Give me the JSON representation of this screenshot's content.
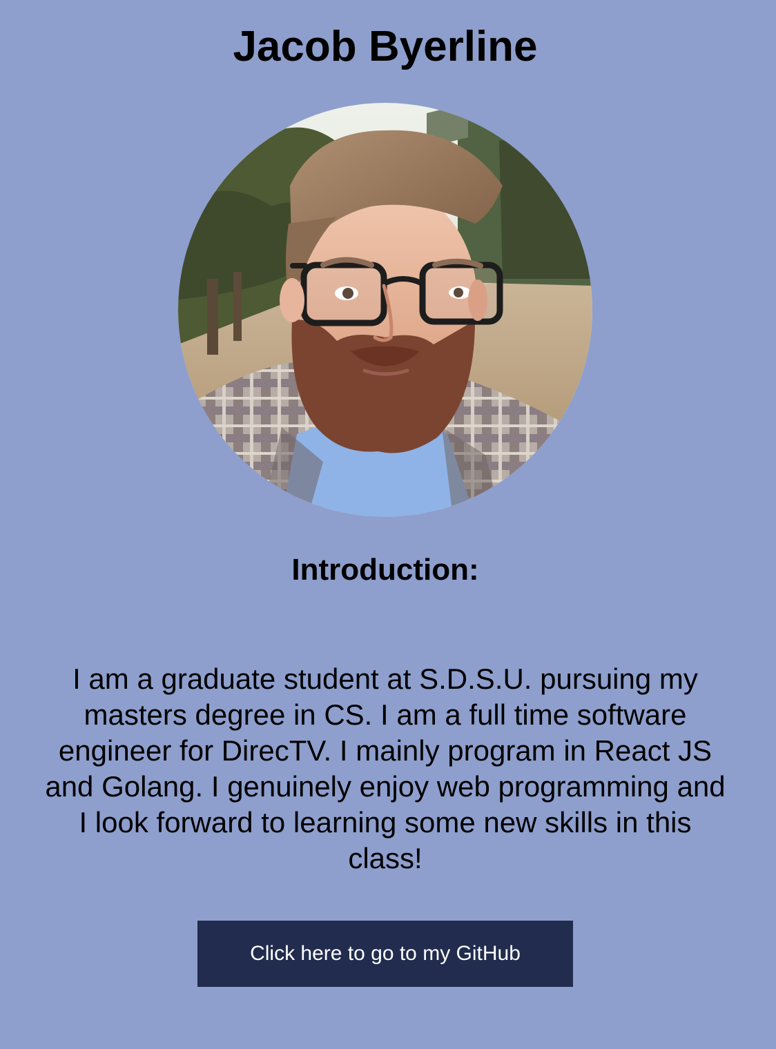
{
  "profile": {
    "name": "Jacob Byerline",
    "photo_alt": "Portrait of Jacob Byerline"
  },
  "intro": {
    "heading": "Introduction:",
    "text": "I am a graduate student at S.D.S.U. pursuing my masters degree in CS. I am a full time software engineer for DirecTV. I mainly program in React JS and Golang. I genuinely enjoy web programming and I look forward to learning some new skills in this class!"
  },
  "actions": {
    "github_label": "Click here to go to my GitHub"
  },
  "colors": {
    "page_background": "#8e9fcd",
    "button_background": "#212c4e",
    "button_text": "#ffffff"
  }
}
